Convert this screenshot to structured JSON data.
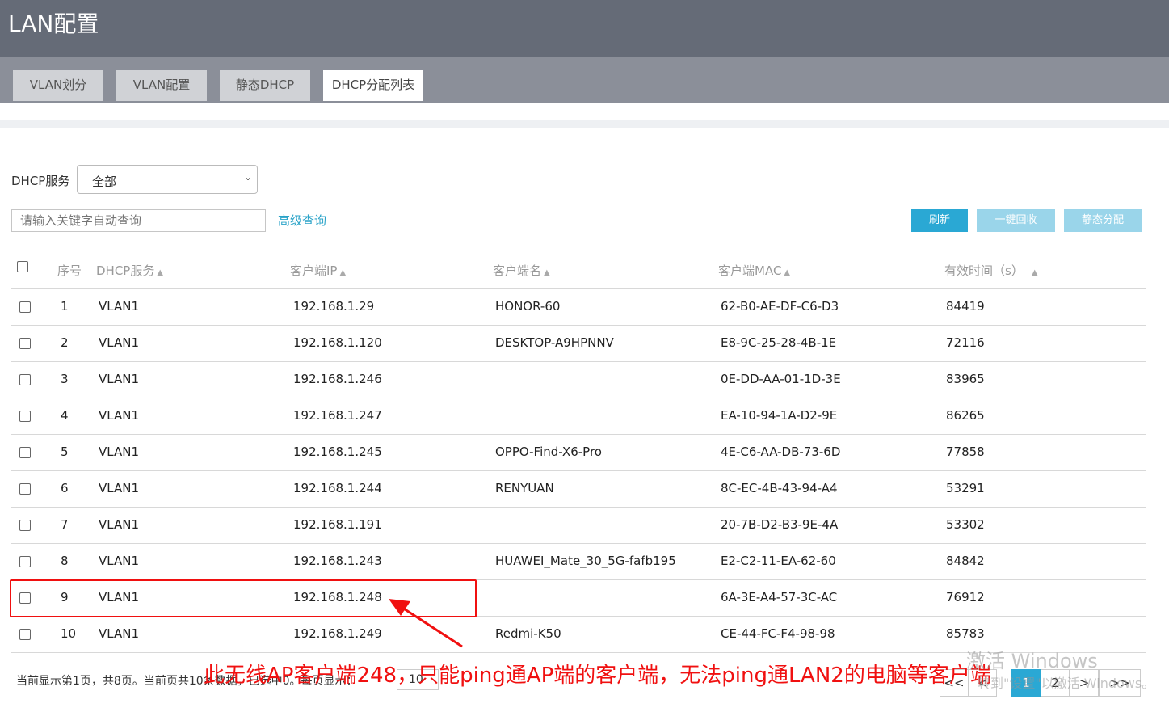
{
  "page": {
    "title": "LAN配置"
  },
  "tabs": [
    {
      "label": "VLAN划分",
      "active": false
    },
    {
      "label": "VLAN配置",
      "active": false
    },
    {
      "label": "静态DHCP",
      "active": false
    },
    {
      "label": "DHCP分配列表",
      "active": true
    }
  ],
  "filter": {
    "dhcp_label": "DHCP服务",
    "dhcp_value": "全部",
    "search_placeholder": "请输入关键字自动查询",
    "advanced_link": "高级查询"
  },
  "buttons": {
    "refresh": "刷新",
    "reclaim": "一键回收",
    "static_assign": "静态分配"
  },
  "table": {
    "headers": {
      "index": "序号",
      "dhcp": "DHCP服务",
      "ip": "客户端IP",
      "name": "客户端名",
      "mac": "客户端MAC",
      "lease": "有效时间（s）"
    },
    "rows": [
      {
        "index": "1",
        "dhcp": "VLAN1",
        "ip": "192.168.1.29",
        "name": "HONOR-60",
        "mac": "62-B0-AE-DF-C6-D3",
        "lease": "84419"
      },
      {
        "index": "2",
        "dhcp": "VLAN1",
        "ip": "192.168.1.120",
        "name": "DESKTOP-A9HPNNV",
        "mac": "E8-9C-25-28-4B-1E",
        "lease": "72116"
      },
      {
        "index": "3",
        "dhcp": "VLAN1",
        "ip": "192.168.1.246",
        "name": "",
        "mac": "0E-DD-AA-01-1D-3E",
        "lease": "83965"
      },
      {
        "index": "4",
        "dhcp": "VLAN1",
        "ip": "192.168.1.247",
        "name": "",
        "mac": "EA-10-94-1A-D2-9E",
        "lease": "86265"
      },
      {
        "index": "5",
        "dhcp": "VLAN1",
        "ip": "192.168.1.245",
        "name": "OPPO-Find-X6-Pro",
        "mac": "4E-C6-AA-DB-73-6D",
        "lease": "77858"
      },
      {
        "index": "6",
        "dhcp": "VLAN1",
        "ip": "192.168.1.244",
        "name": "RENYUAN",
        "mac": "8C-EC-4B-43-94-A4",
        "lease": "53291"
      },
      {
        "index": "7",
        "dhcp": "VLAN1",
        "ip": "192.168.1.191",
        "name": "",
        "mac": "20-7B-D2-B3-9E-4A",
        "lease": "53302"
      },
      {
        "index": "8",
        "dhcp": "VLAN1",
        "ip": "192.168.1.243",
        "name": "HUAWEI_Mate_30_5G-fafb195",
        "mac": "E2-C2-11-EA-62-60",
        "lease": "84842"
      },
      {
        "index": "9",
        "dhcp": "VLAN1",
        "ip": "192.168.1.248",
        "name": "",
        "mac": "6A-3E-A4-57-3C-AC",
        "lease": "76912"
      },
      {
        "index": "10",
        "dhcp": "VLAN1",
        "ip": "192.168.1.249",
        "name": "Redmi-K50",
        "mac": "CE-44-FC-F4-98-98",
        "lease": "85783"
      }
    ]
  },
  "footer": {
    "status": "当前显示第1页，共8页。当前页共10条数据，已选中0。每页显示：",
    "per_page": "10"
  },
  "pagination": {
    "first": "<<",
    "prev": "<",
    "pages": [
      "1",
      "2"
    ],
    "next": ">",
    "last": ">>",
    "current": "1"
  },
  "annotation": {
    "text": "此无线AP客户端248，只能ping通AP端的客户端，无法ping通LAN2的电脑等客户端",
    "color": "#f01010"
  },
  "watermark": {
    "line1": "激活 Windows",
    "line2": "转到\"设置\"以激活 Windows。"
  },
  "colors": {
    "header_bg": "#656b77",
    "tabbar_bg": "#8b8f99",
    "accent": "#2aa8d4",
    "disabled_btn": "#9ad5ea",
    "link": "#2aa3c8"
  }
}
